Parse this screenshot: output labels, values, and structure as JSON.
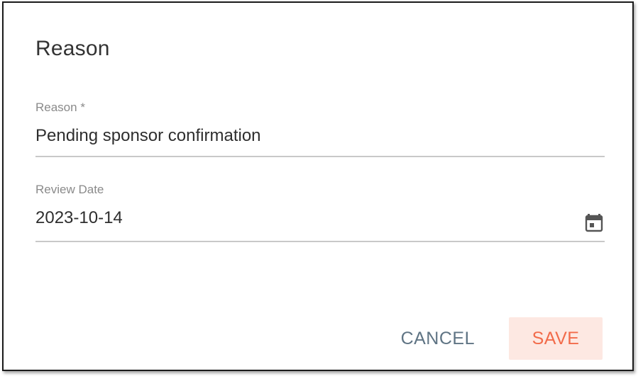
{
  "dialog": {
    "title": "Reason"
  },
  "reason_field": {
    "label": "Reason *",
    "value": "Pending sponsor confirmation"
  },
  "review_date_field": {
    "label": "Review Date",
    "value": "2023-10-14",
    "icon": "calendar-icon"
  },
  "actions": {
    "cancel_label": "CANCEL",
    "save_label": "SAVE"
  },
  "colors": {
    "save_text": "#f26b4a",
    "save_background": "#fde8e2",
    "cancel_text": "#5f7484"
  }
}
